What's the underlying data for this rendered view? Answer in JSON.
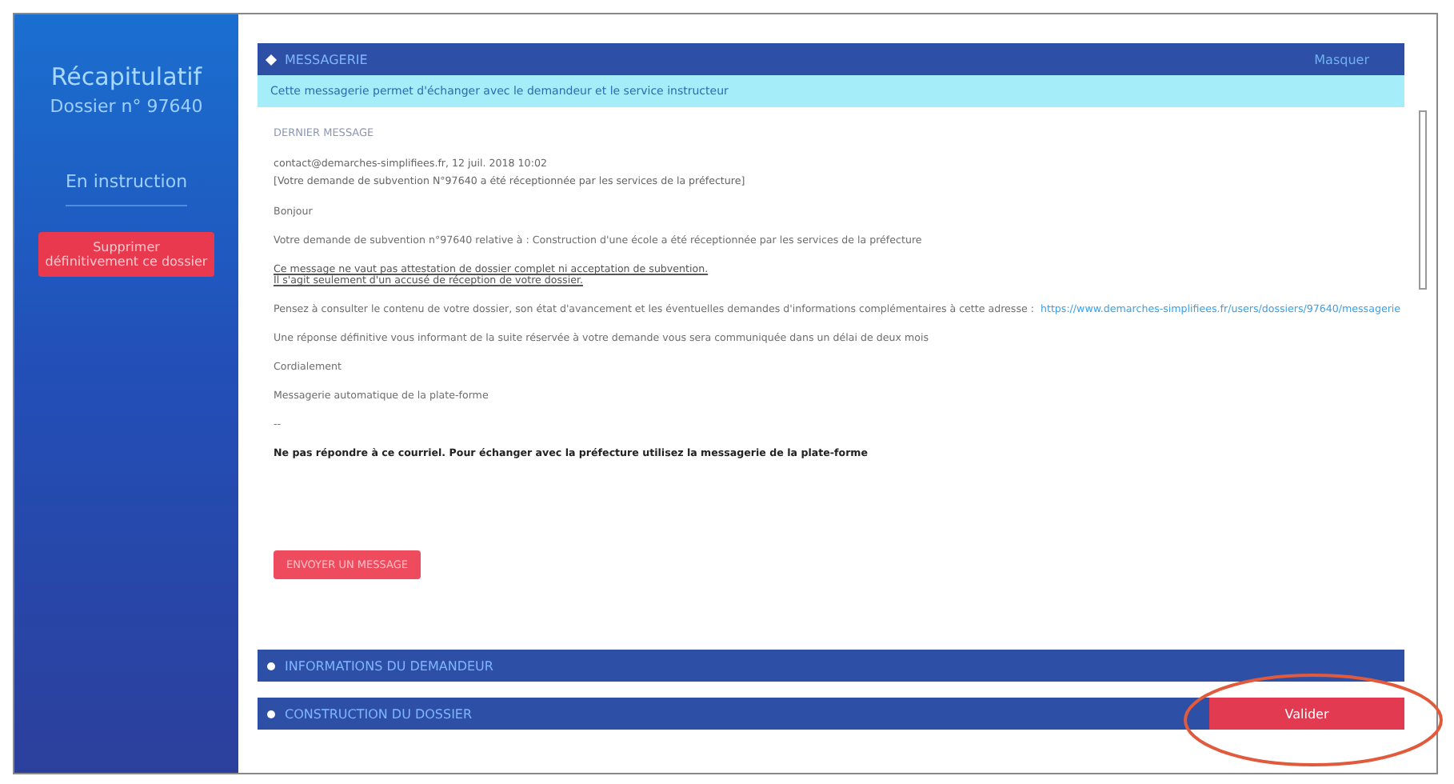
{
  "sidebar": {
    "title": "Récapitulatif",
    "dossier": "Dossier n° 97640",
    "status": "En instruction",
    "delete_button": "Supprimer définitivement ce dossier"
  },
  "sections": [
    {
      "kind": "messaging",
      "title": "MESSAGERIE",
      "expanded": true,
      "action": "Masquer",
      "info": "Cette messagerie permet d'échanger avec le demandeur et le service instructeur",
      "last_label": "DERNIER MESSAGE",
      "message": [
        {
          "kind": "meta",
          "text": "contact@demarches-simplifiees.fr, 12 juil. 2018 10:02"
        },
        {
          "kind": "subject",
          "text": "[Votre demande de subvention N°97640 a été réceptionnée par les services de la préfecture]"
        },
        {
          "kind": "para",
          "text": "Bonjour"
        },
        {
          "kind": "para",
          "text": "Votre demande de subvention n°97640 relative à : Construction d'une école a été réceptionnée par les services de la préfecture"
        },
        {
          "kind": "underline",
          "text": "Ce message ne vaut pas attestation de dossier complet ni acceptation de subvention."
        },
        {
          "kind": "underline",
          "text": "Il s'agit seulement d'un accusé de réception de votre dossier."
        },
        {
          "kind": "para_link",
          "text": "Pensez à consulter le contenu de votre dossier, son état d'avancement et les éventuelles demandes d'informations complémentaires à cette adresse :",
          "link": "https://www.demarches-simplifiees.fr/users/dossiers/97640/messagerie"
        },
        {
          "kind": "para",
          "text": "Une réponse définitive vous informant de la suite réservée à votre demande vous sera communiquée dans un délai de deux mois"
        },
        {
          "kind": "para",
          "text": "Cordialement"
        },
        {
          "kind": "para",
          "text": "Messagerie automatique de la plate-forme"
        },
        {
          "kind": "para",
          "text": "--"
        },
        {
          "kind": "bold",
          "text": "Ne pas répondre à ce courriel. Pour échanger avec la préfecture utilisez la messagerie de la plate-forme"
        }
      ],
      "send_button": "ENVOYER UN MESSAGE"
    },
    {
      "kind": "collapsed",
      "title": "INFORMATIONS DU DEMANDEUR",
      "expanded": false
    },
    {
      "kind": "collapsed",
      "title": "CONSTRUCTION DU DOSSIER",
      "expanded": false,
      "action_button": "Valider"
    }
  ]
}
